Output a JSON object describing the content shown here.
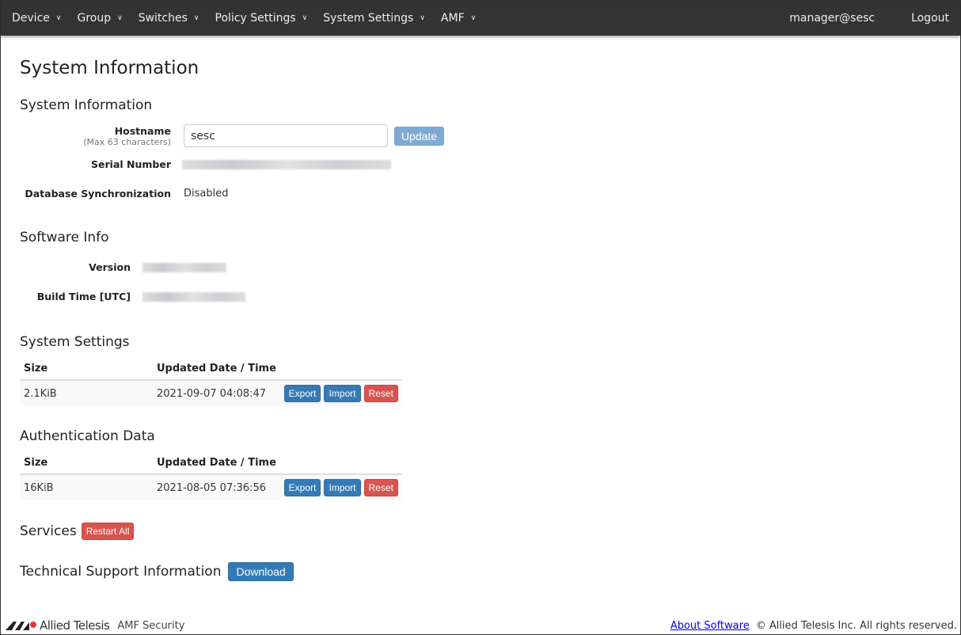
{
  "nav": {
    "items": [
      "Device",
      "Group",
      "Switches",
      "Policy Settings",
      "System Settings",
      "AMF"
    ],
    "user": "manager@sesc",
    "logout": "Logout"
  },
  "page_title": "System Information",
  "sysinfo": {
    "title": "System Information",
    "hostname_label": "Hostname",
    "hostname_hint": "(Max 63 characters)",
    "hostname_value": "sesc",
    "update": "Update",
    "serial_label": "Serial Number",
    "dbsync_label": "Database Synchronization",
    "dbsync_value": "Disabled"
  },
  "software": {
    "title": "Software Info",
    "version_label": "Version",
    "build_label": "Build Time [UTC]"
  },
  "settings": {
    "title": "System Settings",
    "col_size": "Size",
    "col_date": "Updated Date / Time",
    "size": "2.1KiB",
    "date": "2021-09-07 04:08:47",
    "export": "Export",
    "import": "Import",
    "reset": "Reset"
  },
  "auth": {
    "title": "Authentication Data",
    "col_size": "Size",
    "col_date": "Updated Date / Time",
    "size": "16KiB",
    "date": "2021-08-05 07:36:56",
    "export": "Export",
    "import": "Import",
    "reset": "Reset"
  },
  "services": {
    "title": "Services",
    "restart": "Restart All"
  },
  "support": {
    "title": "Technical Support Information",
    "download": "Download"
  },
  "footer": {
    "brand": "Allied Telesis",
    "product": "AMF Security",
    "about": "About Software",
    "copyright": "© Allied Telesis Inc. All rights reserved."
  }
}
